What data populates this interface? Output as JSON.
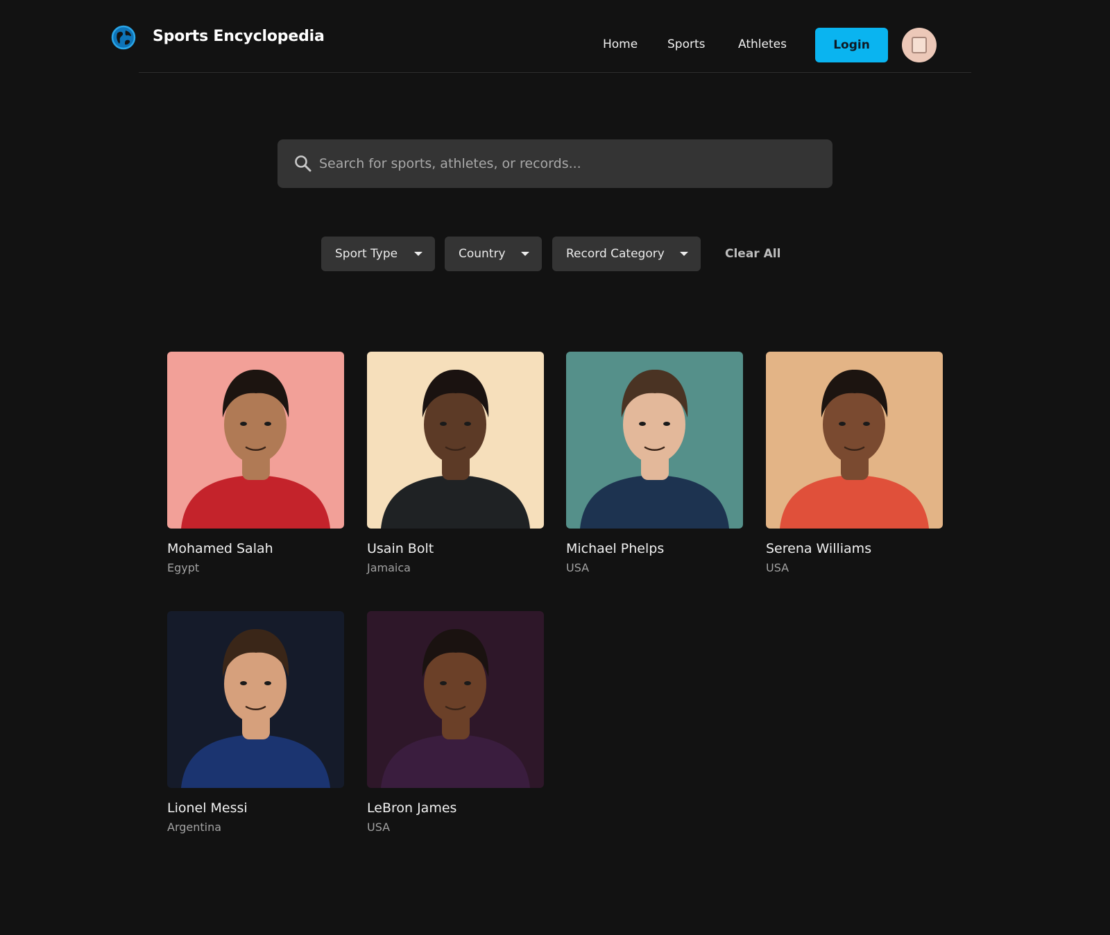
{
  "header": {
    "brand": "Sports Encyclopedia",
    "logo_icon": "globe-icon",
    "nav": [
      "Home",
      "Sports",
      "Athletes"
    ],
    "login_label": "Login",
    "avatar_icon": "avatar-icon"
  },
  "search": {
    "placeholder": "Search for sports, athletes, or records...",
    "icon": "search-icon"
  },
  "filters": {
    "items": [
      "Sport Type",
      "Country",
      "Record Category"
    ],
    "clear_label": "Clear All"
  },
  "athletes": [
    {
      "name": "Mohamed Salah",
      "country": "Egypt",
      "bg": "#f2a098",
      "shirt": "#c4232b",
      "skin": "#b07a55",
      "hair": "#1c1410"
    },
    {
      "name": "Usain Bolt",
      "country": "Jamaica",
      "bg": "#f6dfbb",
      "shirt": "#1f2224",
      "skin": "#5c3a26",
      "hair": "#1a1210"
    },
    {
      "name": "Michael Phelps",
      "country": "USA",
      "bg": "#55908a",
      "shirt": "#1d3350",
      "skin": "#e3b89a",
      "hair": "#4a3323"
    },
    {
      "name": "Serena Williams",
      "country": "USA",
      "bg": "#e3b486",
      "shirt": "#e0503a",
      "skin": "#7a4a30",
      "hair": "#1c1410"
    },
    {
      "name": "Lionel Messi",
      "country": "Argentina",
      "bg": "#151b2a",
      "shirt": "#1b3470",
      "skin": "#d6a07c",
      "hair": "#3a2618"
    },
    {
      "name": "LeBron James",
      "country": "USA",
      "bg": "#2e1729",
      "shirt": "#3a1d3e",
      "skin": "#6b4028",
      "hair": "#1a1210"
    }
  ],
  "colors": {
    "background": "#121212",
    "accent": "#0ab4f0",
    "surface": "#343434"
  }
}
